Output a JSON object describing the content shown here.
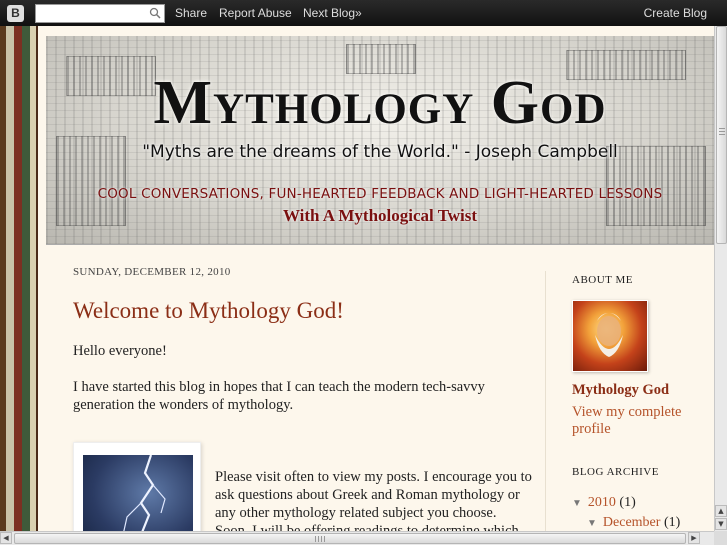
{
  "navbar": {
    "logo": "B",
    "search_value": "",
    "search_icon": "magnifier-icon",
    "links": [
      "Share",
      "Report Abuse",
      "Next Blog»"
    ],
    "create_blog": "Create Blog"
  },
  "header": {
    "title": "Mythology God",
    "quote": "\"Myths are the dreams of the World.\" - Joseph Campbell",
    "tagline": "COOL CONVERSATIONS, FUN-HEARTED FEEDBACK AND LIGHT-HEARTED LESSONS",
    "subtagline": "With A Mythological Twist"
  },
  "post": {
    "date": "Sunday, December 12, 2010",
    "title": "Welcome to Mythology God!",
    "paragraphs": [
      "Hello everyone!",
      "I have started this blog in hopes that I can teach the modern tech-savvy generation the wonders of mythology.",
      "Please visit often to view my posts. I encourage you to ask questions about Greek and Roman mythology or any other mythology related subject you choose. Soon, I will be offering readings to determine which God or Goddess you may be"
    ],
    "image": "lightning-image"
  },
  "sidebar": {
    "about_heading": "About Me",
    "profile_name": "Mythology God",
    "profile_link": "View my complete profile",
    "archive_heading": "Blog Archive",
    "archive": [
      {
        "label": "2010",
        "count": "(1)"
      },
      {
        "label": "December",
        "count": "(1)"
      }
    ]
  },
  "colors": {
    "accent": "#8b2e16",
    "link": "#b5532a",
    "tagline": "#7a1010",
    "page_bg": "#fdf7ec"
  }
}
